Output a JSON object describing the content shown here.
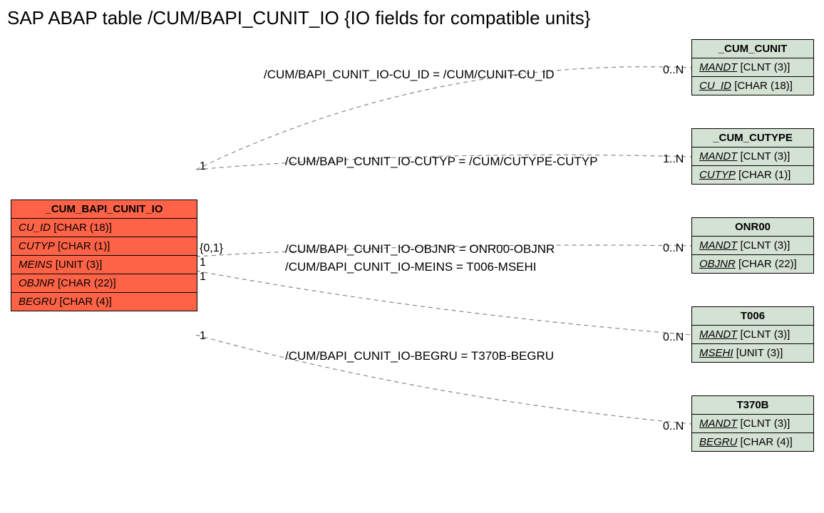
{
  "title": "SAP ABAP table /CUM/BAPI_CUNIT_IO {IO fields for compatible units}",
  "mainEntity": {
    "name": "_CUM_BAPI_CUNIT_IO",
    "fields": [
      {
        "name": "CU_ID",
        "type": "[CHAR (18)]"
      },
      {
        "name": "CUTYP",
        "type": "[CHAR (1)]"
      },
      {
        "name": "MEINS",
        "type": "[UNIT (3)]"
      },
      {
        "name": "OBJNR",
        "type": "[CHAR (22)]"
      },
      {
        "name": "BEGRU",
        "type": "[CHAR (4)]"
      }
    ]
  },
  "refEntities": [
    {
      "name": "_CUM_CUNIT",
      "fields": [
        {
          "name": "MANDT",
          "type": "[CLNT (3)]"
        },
        {
          "name": "CU_ID",
          "type": "[CHAR (18)]"
        }
      ]
    },
    {
      "name": "_CUM_CUTYPE",
      "fields": [
        {
          "name": "MANDT",
          "type": "[CLNT (3)]"
        },
        {
          "name": "CUTYP",
          "type": "[CHAR (1)]"
        }
      ]
    },
    {
      "name": "ONR00",
      "fields": [
        {
          "name": "MANDT",
          "type": "[CLNT (3)]"
        },
        {
          "name": "OBJNR",
          "type": "[CHAR (22)]"
        }
      ]
    },
    {
      "name": "T006",
      "fields": [
        {
          "name": "MANDT",
          "type": "[CLNT (3)]"
        },
        {
          "name": "MSEHI",
          "type": "[UNIT (3)]"
        }
      ]
    },
    {
      "name": "T370B",
      "fields": [
        {
          "name": "MANDT",
          "type": "[CLNT (3)]"
        },
        {
          "name": "BEGRU",
          "type": "[CHAR (4)]"
        }
      ]
    }
  ],
  "relations": [
    {
      "label": "/CUM/BAPI_CUNIT_IO-CU_ID = /CUM/CUNIT-CU_ID",
      "leftCard": "1",
      "rightCard": "0..N"
    },
    {
      "label": "/CUM/BAPI_CUNIT_IO-CUTYP = /CUM/CUTYPE-CUTYP",
      "leftCard": "",
      "rightCard": "1..N"
    },
    {
      "label": "/CUM/BAPI_CUNIT_IO-OBJNR = ONR00-OBJNR",
      "leftCard": "{0,1}",
      "rightCard": "0..N"
    },
    {
      "label": "/CUM/BAPI_CUNIT_IO-MEINS = T006-MSEHI",
      "leftCard": "1",
      "rightCard": "0..N"
    },
    {
      "label": "/CUM/BAPI_CUNIT_IO-BEGRU = T370B-BEGRU",
      "leftCard": "1",
      "rightCard": "0..N"
    }
  ],
  "extraCard": "1"
}
